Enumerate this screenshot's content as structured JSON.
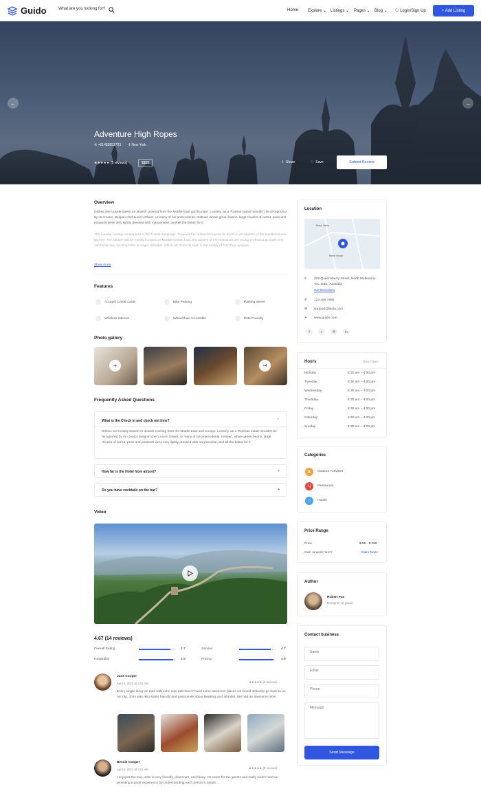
{
  "header": {
    "logo": "Guido",
    "search_placeholder": "What are you looking for?",
    "nav": [
      "Home",
      "Explore",
      "Listings",
      "Pages",
      "Blog"
    ],
    "login": "Login/Sign Up",
    "add_listing": "+ Add Listing"
  },
  "hero": {
    "title": "Adventure High Ropes",
    "phone": "+61483851723",
    "location": "New York",
    "stars": "★★★★★",
    "reviews": "(5 reviews)",
    "price": "$$$$",
    "share": "Share",
    "save": "Save",
    "submit": "Submit Review"
  },
  "overview": {
    "title": "Overview",
    "p1": "Dishes are loosely based on Jewish cooking from the Middle East and Europe. Loosely, as a 'Russian salad' wouldn't be recognized by its creator, Belgian chef Lucien Olivier, or many of his antecedents. Instead, whole green beans, large chunks of carrot, peas and potatoes were very lightly dressed with mayonnaise, and all the better for it.",
    "p2": "The Annalia Lounge means port in the Turkish language, however the restaurant opens its doors to all aspects of the Mediterranean kitchen. The kitchen will be mostly focused on Mediterranean food, the owners of the restaurant are young professional chefs who can bring new, exciting taste to Angel, Islington, which will show through in the quality of food they prepare.",
    "more": "Show more"
  },
  "features": {
    "title": "Features",
    "items": [
      "Accepts Credit Cards",
      "Bike Parking",
      "Parking Street",
      "Wireless Internet",
      "Wheelchair Accessible",
      "Pets Friendly"
    ]
  },
  "gallery": {
    "title": "Photo gallery",
    "more": "+4"
  },
  "faq": {
    "title": "Frequently Asked Questions",
    "q1": "What is the Check in and check out time?",
    "a1": "Dishes are loosely based on Jewish cooking from the Middle East and Europe. Loosely, as a 'Russian salad' wouldn't be recognized by its creator, Belgian chef Lucien Olivier, or many of his antecedents. Instead, whole green beans, large chunks of carrot, peas and potatoes were very lightly dressed with mayonnaise, and all the better for it.",
    "q2": "How far is the Hotel from airport?",
    "q3": "Do you have cocktails on the bar?"
  },
  "video": {
    "title": "Video"
  },
  "rating": {
    "summary": "4.67 (14 reviews)",
    "items": [
      {
        "label": "Overall Rating",
        "value": "4.7",
        "pct": 0.86
      },
      {
        "label": "Service",
        "value": "4.7",
        "pct": 0.86
      },
      {
        "label": "Hospitality",
        "value": "4.9",
        "pct": 0.95
      },
      {
        "label": "Pricing",
        "value": "4.9",
        "pct": 0.95
      }
    ]
  },
  "reviews": [
    {
      "name": "Jane Cooper",
      "date": "April 6, 2021 at 3:21 AM",
      "stars": "★★★★★",
      "count": "(5 reviews)",
      "text": "Every single thing we tried with John was delicious! Found some awesome places we would definitely go back to on our trip. John was also super friendly and passionate about Beşiktaş and Istanbul. We had an awesome time!"
    },
    {
      "name": "Bessie Cooper",
      "date": "April 6, 2021 at 3:21 AM",
      "stars": "★★★★★",
      "count": "(5 reviews)",
      "text": "I enjoyed the tour. John is very friendly, observant, and funny. He cares for the guests and really works hard on providing a good experience by understanding each person's needs...."
    }
  ],
  "location": {
    "title": "Location",
    "map_label1": "Bravo Naive",
    "map_label2": "Better House",
    "address": "329 Queensberry Street, North Melbourne VIC 3051, Australia",
    "directions": "Get Directions",
    "phone": "123 456 7890",
    "email": "support@lisola.com",
    "web": "www.guido.com"
  },
  "hours": {
    "title": "Hours",
    "status": "Now Open",
    "days": [
      {
        "d": "Monday",
        "t": "6:30 am – 4:00 pm"
      },
      {
        "d": "Tuesday",
        "t": "6:30 am – 4:00 pm"
      },
      {
        "d": "Wednesday",
        "t": "6:30 am – 4:00 pm"
      },
      {
        "d": "Thursday",
        "t": "6:30 am – 4:00 pm"
      },
      {
        "d": "Friday",
        "t": "6:30 am – 4:00 pm"
      },
      {
        "d": "Saturday",
        "t": "6:30 am – 4:00 pm"
      },
      {
        "d": "Sunday",
        "t": "6:30 am – 4:00 pm"
      }
    ]
  },
  "categories": {
    "title": "Categories",
    "items": [
      "Outdoor Activities",
      "Restaurant",
      "Hotels"
    ]
  },
  "price": {
    "title": "Price Range",
    "label": "Price",
    "value": "$ 50 - $ 150",
    "own": "Own or work here?",
    "claim": "Claim Now!"
  },
  "author": {
    "title": "Author",
    "name": "Robert Fox",
    "role": "Designer at guido"
  },
  "contact": {
    "title": "Contact business",
    "name": "Name",
    "email": "Email",
    "phone": "Phone",
    "message": "Message",
    "send": "Send Message"
  },
  "colors": {
    "accent": "#3157e0",
    "category_icons": [
      "#f4a23a",
      "#e8453c",
      "#4ea3e8"
    ]
  }
}
